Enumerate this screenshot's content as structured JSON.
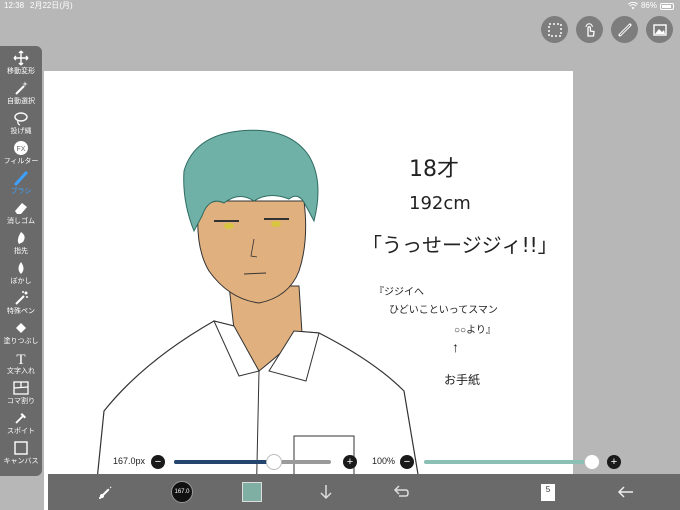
{
  "status": {
    "time": "12:38",
    "date": "2月22日(月)",
    "battery": "86%"
  },
  "top_buttons": [
    "selection-icon",
    "touch-gesture-icon",
    "ruler-icon",
    "gallery-icon"
  ],
  "tools": [
    {
      "label": "移動変形",
      "icon": "move-icon"
    },
    {
      "label": "自動選択",
      "icon": "magic-wand-icon"
    },
    {
      "label": "投げ縄",
      "icon": "lasso-icon"
    },
    {
      "label": "フィルター",
      "icon": "filter-fx-icon",
      "icon_text": "FX"
    },
    {
      "label": "ブラシ",
      "icon": "brush-icon",
      "active": true
    },
    {
      "label": "消しゴム",
      "icon": "eraser-icon"
    },
    {
      "label": "指先",
      "icon": "smudge-icon"
    },
    {
      "label": "ぼかし",
      "icon": "blur-icon"
    },
    {
      "label": "特殊ペン",
      "icon": "special-pen-icon"
    },
    {
      "label": "塗りつぶし",
      "icon": "fill-bucket-icon"
    },
    {
      "label": "文字入れ",
      "icon": "text-icon",
      "icon_text": "T"
    },
    {
      "label": "コマ割り",
      "icon": "frame-divider-icon"
    },
    {
      "label": "スポイト",
      "icon": "eyedropper-icon"
    },
    {
      "label": "キャンバス",
      "icon": "canvas-icon"
    }
  ],
  "brush_size": {
    "label": "167.0px",
    "fraction": 0.64
  },
  "opacity": {
    "label": "100%",
    "fraction": 1.0
  },
  "bottom_bar": {
    "brush_preview_text": "167.0",
    "color": "#7fafa3",
    "layer_count": "5"
  },
  "canvas_text": {
    "age": "18才",
    "height": "192cm",
    "quote": "「うっせージジィ!!」",
    "note_line1": "『ジジイへ",
    "note_line2": "ひどいこといってスマン",
    "note_line3": "○○より』",
    "arrow": "↑",
    "note_caption": "お手紙"
  },
  "colors": {
    "hair": "#6fb1a6",
    "skin": "#e0b07e",
    "toolbar": "#6a6a6a",
    "accent": "#3da2ff"
  }
}
